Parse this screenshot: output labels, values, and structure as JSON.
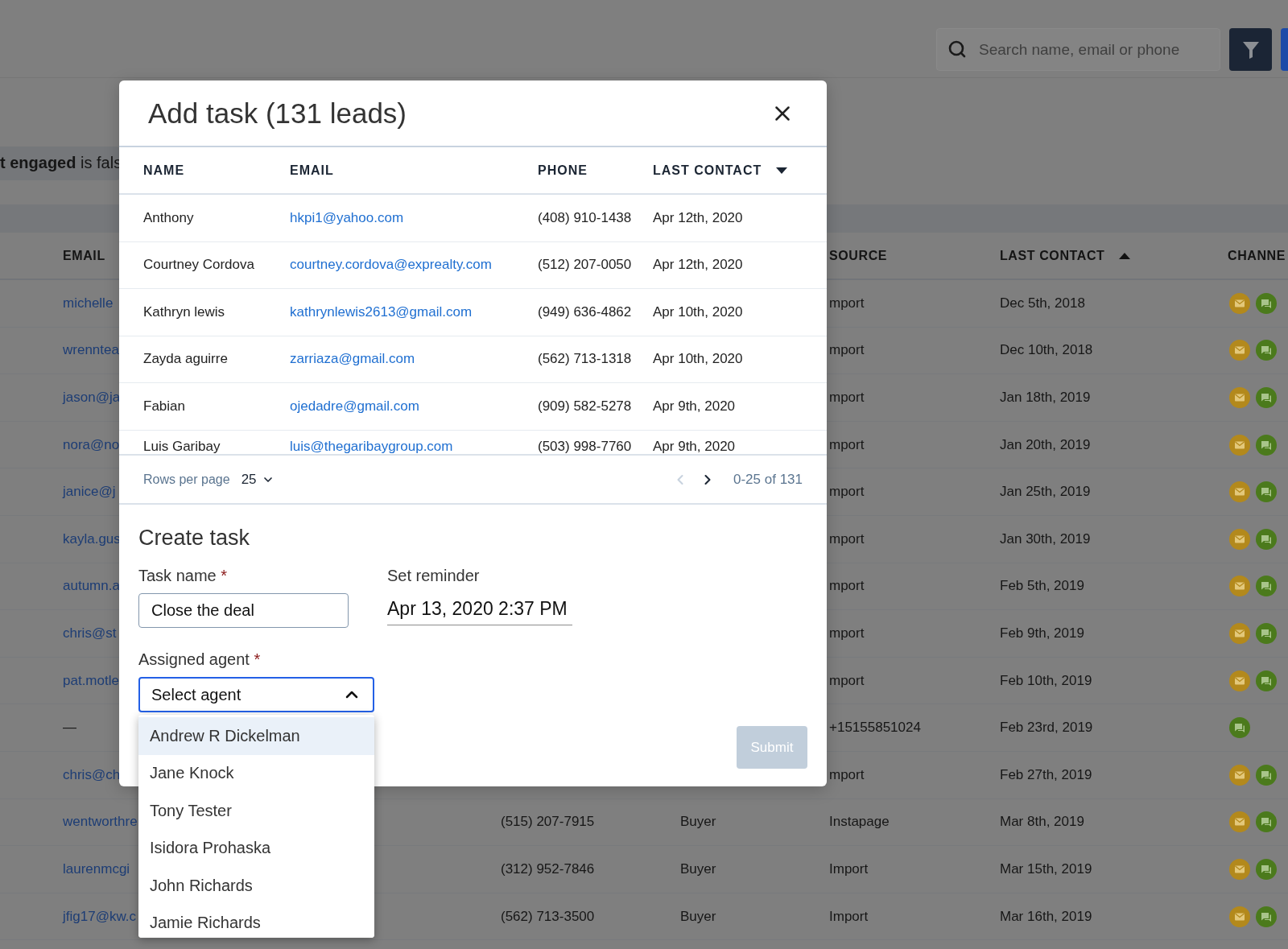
{
  "topbar": {
    "search": {
      "placeholder": "Search name, email or phone"
    }
  },
  "filter_chip": "**t engaged** is fals",
  "leads_table": {
    "columns": [
      {
        "label": "EMAIL"
      },
      {
        "label": "SOURCE"
      },
      {
        "label": "LAST CONTACT",
        "sort_ascending": true
      },
      {
        "label": "CHANNE"
      }
    ],
    "rows": [
      {
        "email": "michelle",
        "source": "mport",
        "last_contact": "Dec 5th, 2018",
        "channels": [
          {
            "kind": "email"
          },
          {
            "kind": "chat"
          }
        ]
      },
      {
        "email": "wrenntea",
        "source": "mport",
        "last_contact": "Dec 10th, 2018",
        "channels": [
          {
            "kind": "email"
          },
          {
            "kind": "chat"
          }
        ]
      },
      {
        "email": "jason@ja",
        "source": "mport",
        "last_contact": "Jan 18th, 2019",
        "channels": [
          {
            "kind": "email"
          },
          {
            "kind": "chat"
          }
        ]
      },
      {
        "email": "nora@no",
        "source": "mport",
        "last_contact": "Jan 20th, 2019",
        "channels": [
          {
            "kind": "email"
          },
          {
            "kind": "chat"
          }
        ]
      },
      {
        "email": "janice@j",
        "source": "mport",
        "last_contact": "Jan 25th, 2019",
        "channels": [
          {
            "kind": "email"
          },
          {
            "kind": "chat"
          }
        ]
      },
      {
        "email": "kayla.gus",
        "source": "mport",
        "last_contact": "Jan 30th, 2019",
        "channels": [
          {
            "kind": "email"
          },
          {
            "kind": "chat"
          }
        ]
      },
      {
        "email": "autumn.a",
        "source": "mport",
        "last_contact": "Feb 5th, 2019",
        "channels": [
          {
            "kind": "email"
          },
          {
            "kind": "chat"
          }
        ]
      },
      {
        "email": "chris@st",
        "source": "mport",
        "last_contact": "Feb 9th, 2019",
        "channels": [
          {
            "kind": "email"
          },
          {
            "kind": "chat"
          }
        ]
      },
      {
        "email": "pat.motle",
        "source": "mport",
        "last_contact": "Feb 10th, 2019",
        "channels": [
          {
            "kind": "email"
          },
          {
            "kind": "chat"
          }
        ]
      },
      {
        "email": "—",
        "source": "+15155851024",
        "last_contact": "Feb 23rd, 2019",
        "channels": [
          {
            "kind": "chat"
          }
        ]
      },
      {
        "email": "chris@ch",
        "source": "mport",
        "last_contact": "Feb 27th, 2019",
        "channels": [
          {
            "kind": "email"
          },
          {
            "kind": "chat"
          }
        ]
      },
      {
        "email": "wentworthre",
        "phone": "(515) 207-7915",
        "type": "Buyer",
        "source": "Instapage",
        "last_contact": "Mar 8th, 2019",
        "channels": [
          {
            "kind": "email"
          },
          {
            "kind": "chat"
          }
        ]
      },
      {
        "email": "laurenmcgi",
        "phone": "(312) 952-7846",
        "type": "Buyer",
        "source": "Import",
        "last_contact": "Mar 15th, 2019",
        "channels": [
          {
            "kind": "email"
          },
          {
            "kind": "chat"
          }
        ]
      },
      {
        "email": "jfig17@kw.c",
        "phone": "(562) 713-3500",
        "type": "Buyer",
        "source": "Import",
        "last_contact": "Mar 16th, 2019",
        "channels": [
          {
            "kind": "email"
          },
          {
            "kind": "chat"
          }
        ]
      }
    ]
  },
  "modal": {
    "title": "Add task (131 leads)",
    "columns": [
      {
        "label": "NAME"
      },
      {
        "label": "EMAIL"
      },
      {
        "label": "PHONE"
      },
      {
        "label": "LAST CONTACT",
        "sort_ascending": false
      }
    ],
    "rows": [
      {
        "name": "Anthony",
        "email": "hkpi1@yahoo.com",
        "phone": "(408) 910-1438",
        "last_contact": "Apr 12th, 2020"
      },
      {
        "name": "Courtney Cordova",
        "email": "courtney.cordova@exprealty.com",
        "phone": "(512) 207-0050",
        "last_contact": "Apr 12th, 2020"
      },
      {
        "name": "Kathryn lewis",
        "email": "kathrynlewis2613@gmail.com",
        "phone": "(949) 636-4862",
        "last_contact": "Apr 10th, 2020"
      },
      {
        "name": "Zayda aguirre",
        "email": "zarriaza@gmail.com",
        "phone": "(562) 713-1318",
        "last_contact": "Apr 10th, 2020"
      },
      {
        "name": "Fabian",
        "email": "ojedadre@gmail.com",
        "phone": "(909) 582-5278",
        "last_contact": "Apr 9th, 2020"
      },
      {
        "name": "Luis Garibay",
        "email": "luis@thegaribaygroup.com",
        "phone": "(503) 998-7760",
        "last_contact": "Apr 9th, 2020"
      }
    ],
    "pagination": {
      "rows_per_page_label": "Rows per page",
      "rows_per_page": "25",
      "range": "0-25 of 131",
      "prev_disabled": true,
      "next_disabled": false
    },
    "form": {
      "title": "Create task",
      "task_name": {
        "label": "Task name",
        "required_mark": "*",
        "value": "Close the deal"
      },
      "reminder": {
        "label": "Set reminder",
        "value": "Apr 13, 2020 2:37 PM"
      },
      "agent": {
        "label": "Assigned agent",
        "required_mark": "*",
        "placeholder": "Select agent",
        "expanded": true,
        "options": [
          {
            "label": "Andrew R Dickelman",
            "selected": true
          },
          {
            "label": "Jane Knock",
            "selected": false
          },
          {
            "label": "Tony Tester",
            "selected": false
          },
          {
            "label": "Isidora Prohaska",
            "selected": false
          },
          {
            "label": "John Richards",
            "selected": false
          },
          {
            "label": "Jamie Richards",
            "selected": false
          }
        ]
      },
      "submit": {
        "label": "Submit",
        "disabled": true
      }
    }
  }
}
